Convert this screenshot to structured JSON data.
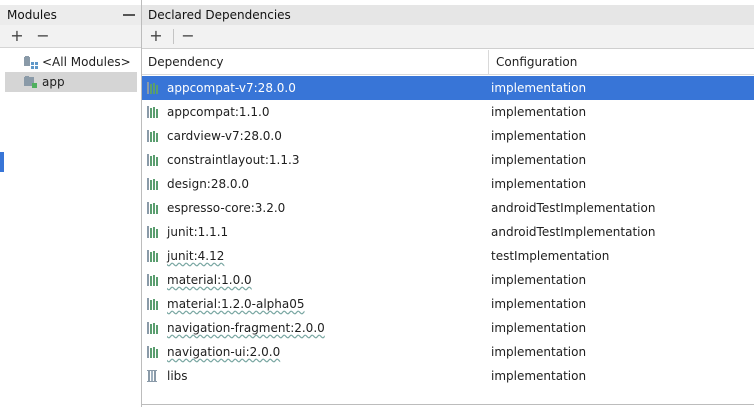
{
  "modules_panel": {
    "title": "Modules",
    "add": "+",
    "remove": "−",
    "items": [
      {
        "label": "<All Modules>",
        "icon": "all-modules-icon"
      },
      {
        "label": "app",
        "icon": "app-module-icon"
      }
    ],
    "selected": "app"
  },
  "deps_panel": {
    "title": "Declared Dependencies",
    "add": "+",
    "remove": "−",
    "columns": {
      "dependency": "Dependency",
      "configuration": "Configuration"
    },
    "rows": [
      {
        "name": "appcompat-v7:28.0.0",
        "config": "implementation",
        "icon": "library-icon",
        "selected": true,
        "wavy": false
      },
      {
        "name": "appcompat:1.1.0",
        "config": "implementation",
        "icon": "library-icon",
        "selected": false,
        "wavy": false
      },
      {
        "name": "cardview-v7:28.0.0",
        "config": "implementation",
        "icon": "library-icon",
        "selected": false,
        "wavy": false
      },
      {
        "name": "constraintlayout:1.1.3",
        "config": "implementation",
        "icon": "library-icon",
        "selected": false,
        "wavy": false
      },
      {
        "name": "design:28.0.0",
        "config": "implementation",
        "icon": "library-icon",
        "selected": false,
        "wavy": false
      },
      {
        "name": "espresso-core:3.2.0",
        "config": "androidTestImplementation",
        "icon": "library-icon",
        "selected": false,
        "wavy": false
      },
      {
        "name": "junit:1.1.1",
        "config": "androidTestImplementation",
        "icon": "library-icon",
        "selected": false,
        "wavy": false
      },
      {
        "name": "junit:4.12",
        "config": "testImplementation",
        "icon": "library-icon",
        "selected": false,
        "wavy": true
      },
      {
        "name": "material:1.0.0",
        "config": "implementation",
        "icon": "library-icon",
        "selected": false,
        "wavy": true
      },
      {
        "name": "material:1.2.0-alpha05",
        "config": "implementation",
        "icon": "library-icon",
        "selected": false,
        "wavy": true
      },
      {
        "name": "navigation-fragment:2.0.0",
        "config": "implementation",
        "icon": "library-icon",
        "selected": false,
        "wavy": true
      },
      {
        "name": "navigation-ui:2.0.0",
        "config": "implementation",
        "icon": "library-icon",
        "selected": false,
        "wavy": true
      },
      {
        "name": "libs",
        "config": "implementation",
        "icon": "jar-library-icon",
        "selected": false,
        "wavy": false
      }
    ]
  },
  "colors": {
    "selection": "#3875d7",
    "icon_green": "#5a9e6f",
    "icon_gray": "#8a9aa8",
    "icon_blue": "#5f98c9"
  }
}
